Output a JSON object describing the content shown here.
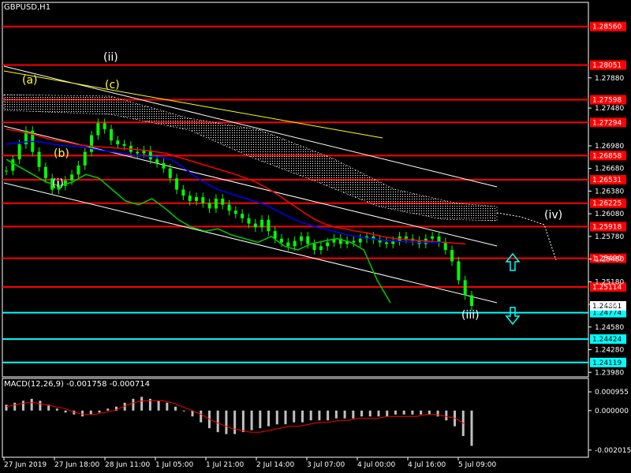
{
  "chart_data": {
    "type": "candlestick",
    "title": "GBPUSD,H1",
    "price_axis": {
      "ylim": [
        1.2392,
        1.2888
      ],
      "ticks": [
        1.2788,
        1.2748,
        1.2698,
        1.2668,
        1.2638,
        1.2608,
        1.2578,
        1.2548,
        1.2518,
        1.2488,
        1.2458,
        1.2428,
        1.2398
      ],
      "tick_labels": [
        "1.27880",
        "1.27480",
        "1.26980",
        "1.26680",
        "1.26380",
        "1.26080",
        "1.25780",
        "1.25480",
        "1.25180",
        "1.24880",
        "1.24580",
        "1.24280",
        "1.23980"
      ]
    },
    "time_axis": {
      "labels": [
        "27 Jun 2019",
        "27 Jun 18:00",
        "28 Jun 11:00",
        "1 Jul 05:00",
        "1 Jul 21:00",
        "2 Jul 14:00",
        "3 Jul 07:00",
        "4 Jul 00:00",
        "4 Jul 16:00",
        "5 Jul 09:00"
      ]
    },
    "levels": [
      {
        "value": 1.2856,
        "label": "1.28560",
        "color": "#ff0000"
      },
      {
        "value": 1.2805,
        "label": "1.28051",
        "color": "#ff0000"
      },
      {
        "value": 1.2759,
        "label": "1.27598",
        "color": "#ff0000"
      },
      {
        "value": 1.2729,
        "label": "1.27294",
        "color": "#ff0000"
      },
      {
        "value": 1.2685,
        "label": "1.26858",
        "color": "#ff0000"
      },
      {
        "value": 1.2653,
        "label": "1.26531",
        "color": "#ff0000"
      },
      {
        "value": 1.2622,
        "label": "1.26225",
        "color": "#ff0000"
      },
      {
        "value": 1.2591,
        "label": "1.25918",
        "color": "#ff0000"
      },
      {
        "value": 1.2549,
        "label": "1.25490",
        "color": "#ff0000"
      },
      {
        "value": 1.2511,
        "label": "1.25114",
        "color": "#ff0000"
      },
      {
        "value": 1.2477,
        "label": "1.24774",
        "color": "#00ffff"
      },
      {
        "value": 1.2442,
        "label": "1.24424",
        "color": "#00ffff"
      },
      {
        "value": 1.2411,
        "label": "1.24119",
        "color": "#00ffff"
      }
    ],
    "current_price": {
      "value": 1.2486,
      "label": "1.24861"
    },
    "wave_labels": [
      {
        "text": "(ii)",
        "color": "#ffffff"
      },
      {
        "text": "(a)",
        "color": "#ffff33"
      },
      {
        "text": "(c)",
        "color": "#ffff33"
      },
      {
        "text": "(b)",
        "color": "#ffff33"
      },
      {
        "text": "(i)",
        "color": "#ffffff"
      },
      {
        "text": "(iii)",
        "color": "#ffffff"
      },
      {
        "text": "(iv)",
        "color": "#ffffff"
      }
    ],
    "price_series": [
      1.2665,
      1.268,
      1.27,
      1.2718,
      1.269,
      1.267,
      1.2655,
      1.264,
      1.2645,
      1.2652,
      1.266,
      1.2672,
      1.269,
      1.2712,
      1.2728,
      1.272,
      1.2705,
      1.27,
      1.2698,
      1.269,
      1.2688,
      1.2692,
      1.268,
      1.2675,
      1.2668,
      1.2655,
      1.264,
      1.2632,
      1.2625,
      1.263,
      1.2622,
      1.2615,
      1.2628,
      1.262,
      1.2612,
      1.2608,
      1.2602,
      1.2595,
      1.259,
      1.26,
      1.2585,
      1.2575,
      1.257,
      1.2565,
      1.2572,
      1.2578,
      1.2568,
      1.256,
      1.2565,
      1.257,
      1.2575,
      1.2568,
      1.2572,
      1.257,
      1.2575,
      1.2578,
      1.2574,
      1.257,
      1.2568,
      1.2572,
      1.2578,
      1.2575,
      1.2572,
      1.2568,
      1.2575,
      1.2578,
      1.257,
      1.256,
      1.2545,
      1.252,
      1.25,
      1.2486
    ],
    "ma_red": [
      1.272,
      1.2718,
      1.2715,
      1.2712,
      1.2708,
      1.2705,
      1.2703,
      1.27,
      1.2698,
      1.2697,
      1.2696,
      1.2695,
      1.2694,
      1.2693,
      1.2692,
      1.269,
      1.2688,
      1.2684,
      1.268,
      1.2676,
      1.2672,
      1.2668,
      1.2664,
      1.266,
      1.2655,
      1.265,
      1.2643,
      1.2635,
      1.2626,
      1.2617,
      1.2608,
      1.26,
      1.2594,
      1.259,
      1.2588,
      1.2585,
      1.2583,
      1.258,
      1.2577,
      1.2575,
      1.2574,
      1.2573,
      1.2572,
      1.2571,
      1.257,
      1.2569,
      1.2568
    ],
    "ma_blue": [
      1.27,
      1.2702,
      1.2704,
      1.2703,
      1.27,
      1.2698,
      1.2697,
      1.2695,
      1.2692,
      1.269,
      1.2688,
      1.2685,
      1.2684,
      1.2683,
      1.268,
      1.267,
      1.2658,
      1.2648,
      1.264,
      1.2635,
      1.263,
      1.2625,
      1.262,
      1.2612,
      1.2604,
      1.2597,
      1.2592,
      1.2588,
      1.2584,
      1.258,
      1.2577,
      1.2575,
      1.2573,
      1.2572,
      1.2571,
      1.257,
      1.257,
      1.257
    ],
    "ma_green": [
      1.268,
      1.267,
      1.266,
      1.265,
      1.2645,
      1.265,
      1.266,
      1.2655,
      1.264,
      1.2625,
      1.262,
      1.2628,
      1.2615,
      1.26,
      1.259,
      1.2585,
      1.2588,
      1.258,
      1.2575,
      1.257,
      1.2578,
      1.2565,
      1.256,
      1.2568,
      1.2572,
      1.2575,
      1.257,
      1.256,
      1.252,
      1.249
    ],
    "macd": {
      "label": "MACD(12,26,9) -0.001758 -0.000714",
      "ylim": [
        -0.0023,
        0.0014
      ],
      "ticks": [
        0.000955,
        0.0,
        -0.002015
      ],
      "tick_labels": [
        "0.000955",
        "0.000000",
        "-0.002015"
      ],
      "histogram": [
        0.0003,
        0.0004,
        0.0005,
        0.0006,
        0.0005,
        0.0003,
        0.0001,
        -0.0001,
        -0.0002,
        -0.0003,
        -0.0002,
        -0.0001,
        0.0001,
        0.0002,
        0.0004,
        0.0006,
        0.0007,
        0.0006,
        0.0005,
        0.0004,
        0.0002,
        0.0,
        -0.0003,
        -0.0006,
        -0.0009,
        -0.0011,
        -0.0012,
        -0.0012,
        -0.0011,
        -0.001,
        -0.0009,
        -0.0008,
        -0.0007,
        -0.0007,
        -0.0006,
        -0.0006,
        -0.0005,
        -0.0005,
        -0.0005,
        -0.0004,
        -0.0004,
        -0.0004,
        -0.0003,
        -0.0003,
        -0.0003,
        -0.0003,
        -0.0002,
        -0.0002,
        -0.0002,
        -0.0002,
        -0.0002,
        -0.0003,
        -0.0005,
        -0.0008,
        -0.0013,
        -0.0018
      ],
      "signal": [
        0.0002,
        0.0003,
        0.0004,
        0.0004,
        0.0003,
        0.0002,
        0.0001,
        -0.0001,
        -0.0002,
        -0.0002,
        -0.0001,
        0.0,
        0.0002,
        0.0004,
        0.0005,
        0.0005,
        0.0005,
        0.0004,
        0.0002,
        0.0,
        -0.0002,
        -0.0005,
        -0.0007,
        -0.0009,
        -0.001,
        -0.0011,
        -0.0011,
        -0.001,
        -0.0009,
        -0.0008,
        -0.0008,
        -0.0007,
        -0.0006,
        -0.0006,
        -0.0005,
        -0.0005,
        -0.0004,
        -0.0004,
        -0.0004,
        -0.0003,
        -0.0003,
        -0.0003,
        -0.0003,
        -0.0002,
        -0.0002,
        -0.0003,
        -0.0004,
        -0.0007
      ]
    },
    "colors": {
      "background": "#000000",
      "candle": "#00ff00",
      "level_resistance": "#ff0000",
      "level_support": "#00ffff",
      "cloud": "#ffffff",
      "channel": "#ffffff",
      "trendline": "#ffff00",
      "ma_red": "#ff0000",
      "ma_blue": "#0000ff",
      "ma_green": "#00cc00",
      "macd_hist": "#c0c0c0",
      "macd_signal": "#ff0000"
    },
    "grid": false
  }
}
